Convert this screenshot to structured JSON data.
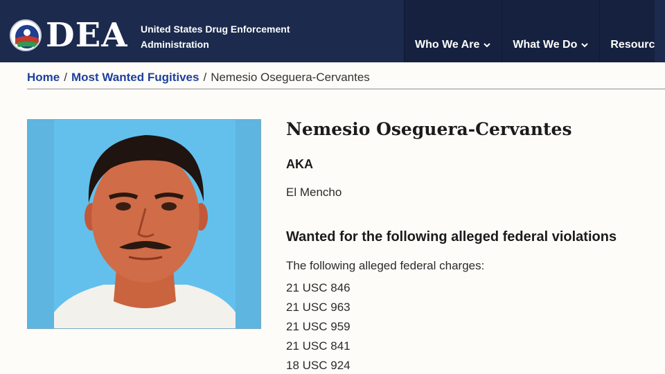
{
  "header": {
    "logo_text": "DEA",
    "agency_line1": "United States Drug Enforcement",
    "agency_line2": "Administration",
    "nav": [
      {
        "label": "Who We Are"
      },
      {
        "label": "What We Do"
      },
      {
        "label": "Resourc"
      }
    ]
  },
  "breadcrumb": {
    "home": "Home",
    "section": "Most Wanted Fugitives",
    "separator": "/",
    "current": "Nemesio Oseguera-Cervantes"
  },
  "profile": {
    "name": "Nemesio Oseguera-Cervantes",
    "aka_label": "AKA",
    "aka_value": "El Mencho",
    "wanted_heading": "Wanted for the following alleged federal violations",
    "charges_intro": "The following alleged federal charges:",
    "charges": [
      "21 USC 846",
      "21 USC 963",
      "21 USC 959",
      "21 USC 841",
      "18 USC 924"
    ]
  },
  "colors": {
    "header_bg": "#1c2a4e",
    "link": "#1e3f9e",
    "photo_bg": "#5db5e0"
  }
}
